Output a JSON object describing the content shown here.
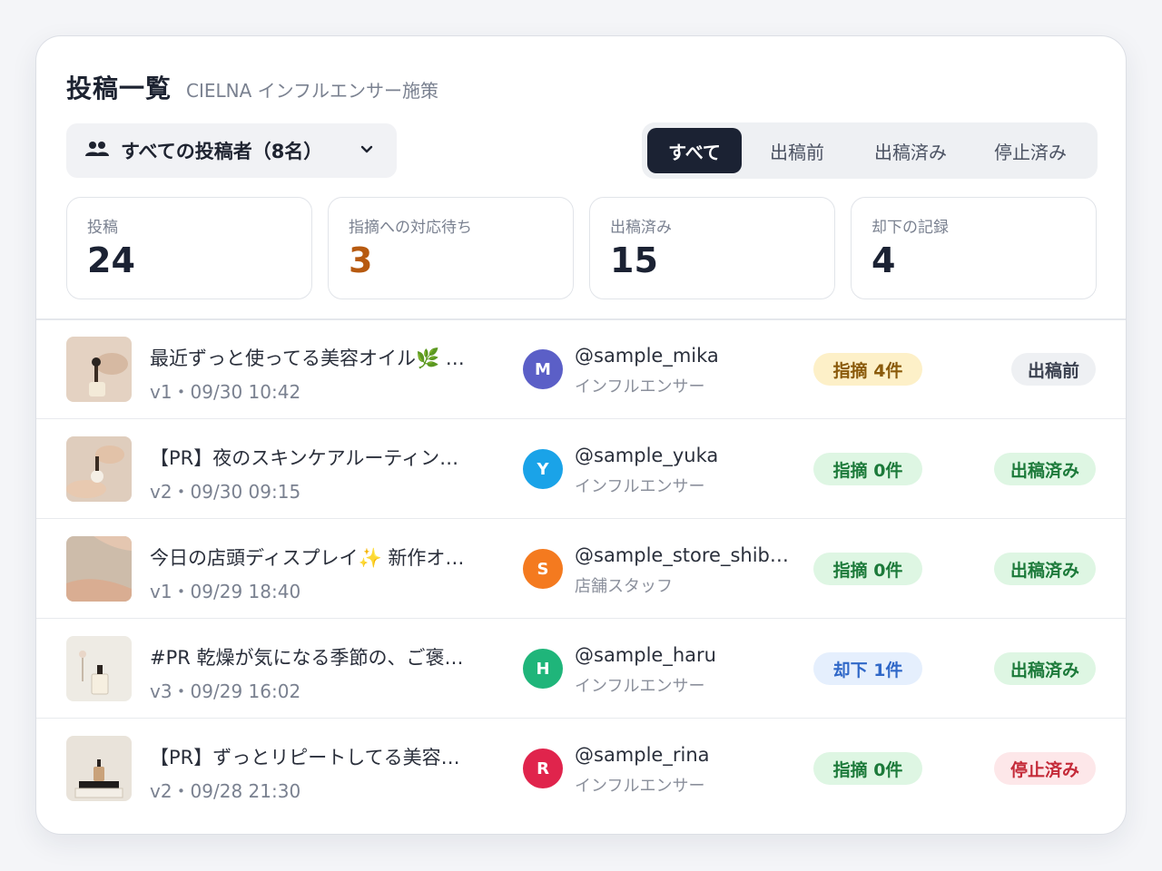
{
  "header": {
    "title": "投稿一覧",
    "subtitle": "CIELNA インフルエンサー施策"
  },
  "filter": {
    "label": "すべての投稿者（8名）",
    "icon": "people-icon"
  },
  "tabs": [
    {
      "label": "すべて",
      "active": true
    },
    {
      "label": "出稿前",
      "active": false
    },
    {
      "label": "出稿済み",
      "active": false
    },
    {
      "label": "停止済み",
      "active": false
    }
  ],
  "stats": [
    {
      "label": "投稿",
      "value": "24"
    },
    {
      "label": "指摘への対応待ち",
      "value": "3"
    },
    {
      "label": "出稿済み",
      "value": "15"
    },
    {
      "label": "却下の記録",
      "value": "4"
    }
  ],
  "colors": {
    "accent_dark": "#1b2233",
    "pending_orange": "#b75a10",
    "avatar_m": "#5b5fc7",
    "avatar_y": "#1aa3e8",
    "avatar_s": "#f47a1f",
    "avatar_h": "#1fb57a",
    "avatar_r": "#e0244c"
  },
  "posts": [
    {
      "title": "最近ずっと使ってる美容オイル🌿 …",
      "meta": "v1・09/30 10:42",
      "avatar": "M",
      "handle": "@sample_mika",
      "role": "インフルエンサー",
      "issue": "指摘 4件",
      "status": "出稿前"
    },
    {
      "title": "【PR】夜のスキンケアルーティン…",
      "meta": "v2・09/30 09:15",
      "avatar": "Y",
      "handle": "@sample_yuka",
      "role": "インフルエンサー",
      "issue": "指摘 0件",
      "status": "出稿済み"
    },
    {
      "title": "今日の店頭ディスプレイ✨ 新作オ…",
      "meta": "v1・09/29 18:40",
      "avatar": "S",
      "handle": "@sample_store_shib…",
      "role": "店舗スタッフ",
      "issue": "指摘 0件",
      "status": "出稿済み"
    },
    {
      "title": "#PR 乾燥が気になる季節の、ご褒…",
      "meta": "v3・09/29 16:02",
      "avatar": "H",
      "handle": "@sample_haru",
      "role": "インフルエンサー",
      "issue": "却下 1件",
      "status": "出稿済み"
    },
    {
      "title": "【PR】ずっとリピートしてる美容…",
      "meta": "v2・09/28 21:30",
      "avatar": "R",
      "handle": "@sample_rina",
      "role": "インフルエンサー",
      "issue": "指摘 0件",
      "status": "停止済み"
    }
  ]
}
